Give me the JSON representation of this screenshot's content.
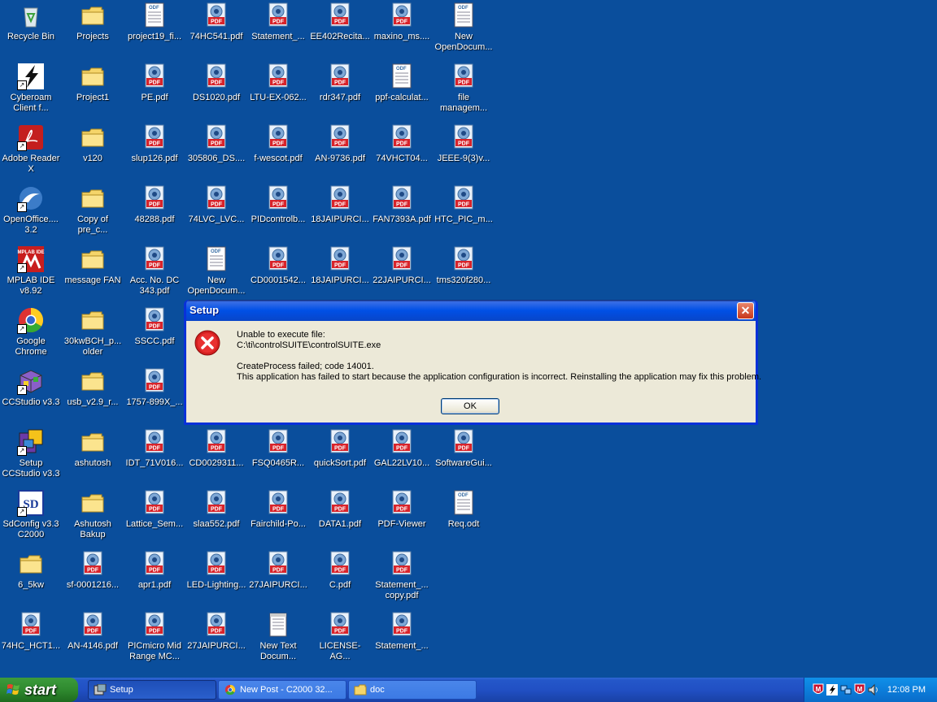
{
  "desktop_icons": [
    {
      "label": "Recycle Bin",
      "type": "recycle"
    },
    {
      "label": "Projects",
      "type": "folder"
    },
    {
      "label": "project19_fi...",
      "type": "odf"
    },
    {
      "label": "74HC541.pdf",
      "type": "pdf"
    },
    {
      "label": "Statement_...",
      "type": "pdf"
    },
    {
      "label": "EE402Recita...",
      "type": "pdf"
    },
    {
      "label": "maxino_ms....",
      "type": "pdf"
    },
    {
      "label": "New OpenDocum...",
      "type": "odf"
    },
    {
      "label": "Cyberoam Client f...",
      "type": "cyberoam"
    },
    {
      "label": "Project1",
      "type": "folder"
    },
    {
      "label": "PE.pdf",
      "type": "pdf"
    },
    {
      "label": "DS1020.pdf",
      "type": "pdf"
    },
    {
      "label": "LTU-EX-062...",
      "type": "pdf"
    },
    {
      "label": "rdr347.pdf",
      "type": "pdf"
    },
    {
      "label": "ppf-calculat...",
      "type": "odf"
    },
    {
      "label": "file managem...",
      "type": "pdf"
    },
    {
      "label": "Adobe Reader X",
      "type": "adobe"
    },
    {
      "label": "v120",
      "type": "folder"
    },
    {
      "label": "slup126.pdf",
      "type": "pdf"
    },
    {
      "label": "305806_DS....",
      "type": "pdf"
    },
    {
      "label": "f-wescot.pdf",
      "type": "pdf"
    },
    {
      "label": "AN-9736.pdf",
      "type": "pdf"
    },
    {
      "label": "74VHCT04...",
      "type": "pdf"
    },
    {
      "label": "JEEE-9(3)v...",
      "type": "pdf"
    },
    {
      "label": "OpenOffice.... 3.2",
      "type": "openoffice"
    },
    {
      "label": "Copy of pre_c...",
      "type": "folder"
    },
    {
      "label": "48288.pdf",
      "type": "pdf"
    },
    {
      "label": "74LVC_LVC...",
      "type": "pdf"
    },
    {
      "label": "PIDcontrolb...",
      "type": "pdf"
    },
    {
      "label": "18JAIPURCI...",
      "type": "pdf"
    },
    {
      "label": "FAN7393A.pdf",
      "type": "pdf"
    },
    {
      "label": "HTC_PIC_m...",
      "type": "pdf"
    },
    {
      "label": "MPLAB IDE v8.92",
      "type": "mplab"
    },
    {
      "label": "message FAN",
      "type": "folder"
    },
    {
      "label": "Acc. No. DC 343.pdf",
      "type": "pdf"
    },
    {
      "label": "New OpenDocum...",
      "type": "odf"
    },
    {
      "label": "CD0001542...",
      "type": "pdf"
    },
    {
      "label": "18JAIPURCI...",
      "type": "pdf"
    },
    {
      "label": "22JAIPURCI...",
      "type": "pdf"
    },
    {
      "label": "tms320f280...",
      "type": "pdf"
    },
    {
      "label": "Google Chrome",
      "type": "chrome"
    },
    {
      "label": "30kwBCH_p... older",
      "type": "folder"
    },
    {
      "label": "SSCC.pdf",
      "type": "pdf"
    },
    {
      "label": "CCStudio v3.3",
      "type": "ccstudio"
    },
    {
      "label": "usb_v2.9_r...",
      "type": "folder"
    },
    {
      "label": "1757-899X_...",
      "type": "pdf"
    },
    {
      "label": "Setup CCStudio v3.3",
      "type": "setup"
    },
    {
      "label": "ashutosh",
      "type": "folder"
    },
    {
      "label": "IDT_71V016...",
      "type": "pdf"
    },
    {
      "label": "CD0029311...",
      "type": "pdf"
    },
    {
      "label": "FSQ0465R...",
      "type": "pdf"
    },
    {
      "label": "quickSort.pdf",
      "type": "pdf"
    },
    {
      "label": "GAL22LV10...",
      "type": "pdf"
    },
    {
      "label": "SoftwareGui...",
      "type": "pdf"
    },
    {
      "label": "SdConfig v3.3 C2000",
      "type": "sdconfig"
    },
    {
      "label": "Ashutosh Bakup",
      "type": "folder"
    },
    {
      "label": "Lattice_Sem...",
      "type": "pdf"
    },
    {
      "label": "slaa552.pdf",
      "type": "pdf"
    },
    {
      "label": "Fairchild-Po...",
      "type": "pdf"
    },
    {
      "label": "DATA1.pdf",
      "type": "pdf"
    },
    {
      "label": "PDF-Viewer",
      "type": "pdf"
    },
    {
      "label": "Req.odt",
      "type": "odf"
    },
    {
      "label": "6_5kw",
      "type": "folder"
    },
    {
      "label": "sf-0001216...",
      "type": "pdf"
    },
    {
      "label": "apr1.pdf",
      "type": "pdf"
    },
    {
      "label": "LED-Lighting...",
      "type": "pdf"
    },
    {
      "label": "27JAIPURCI...",
      "type": "pdf"
    },
    {
      "label": "C.pdf",
      "type": "pdf"
    },
    {
      "label": "Statement_... copy.pdf",
      "type": "pdf"
    },
    {
      "label": "74HC_HCT1...",
      "type": "pdf"
    },
    {
      "label": "AN-4146.pdf",
      "type": "pdf"
    },
    {
      "label": "PICmicro Mid Range MC...",
      "type": "pdf"
    },
    {
      "label": "27JAIPURCI...",
      "type": "pdf"
    },
    {
      "label": "New Text Docum...",
      "type": "txt"
    },
    {
      "label": "LICENSE-AG...",
      "type": "pdf"
    },
    {
      "label": "Statement_...",
      "type": "pdf"
    }
  ],
  "dialog": {
    "title": "Setup",
    "close_glyph": "✕",
    "lines": [
      "Unable to execute file:",
      "C:\\ti\\controlSUITE\\controlSUITE.exe",
      "",
      "CreateProcess failed; code 14001.",
      "This application has failed to start because the application configuration is incorrect. Reinstalling the application may fix this problem."
    ],
    "ok_label": "OK"
  },
  "taskbar": {
    "start_label": "start",
    "buttons": [
      {
        "label": "Setup",
        "icon": "setup-icon",
        "active": true
      },
      {
        "label": "New Post - C2000 32...",
        "icon": "chrome-icon",
        "active": false
      },
      {
        "label": "doc",
        "icon": "folder-icon",
        "active": false
      }
    ],
    "clock": "12:08 PM"
  },
  "colors": {
    "desktop": "#0a4e9c",
    "pdf_red": "#d8232a",
    "folder": "#f5d56a"
  }
}
